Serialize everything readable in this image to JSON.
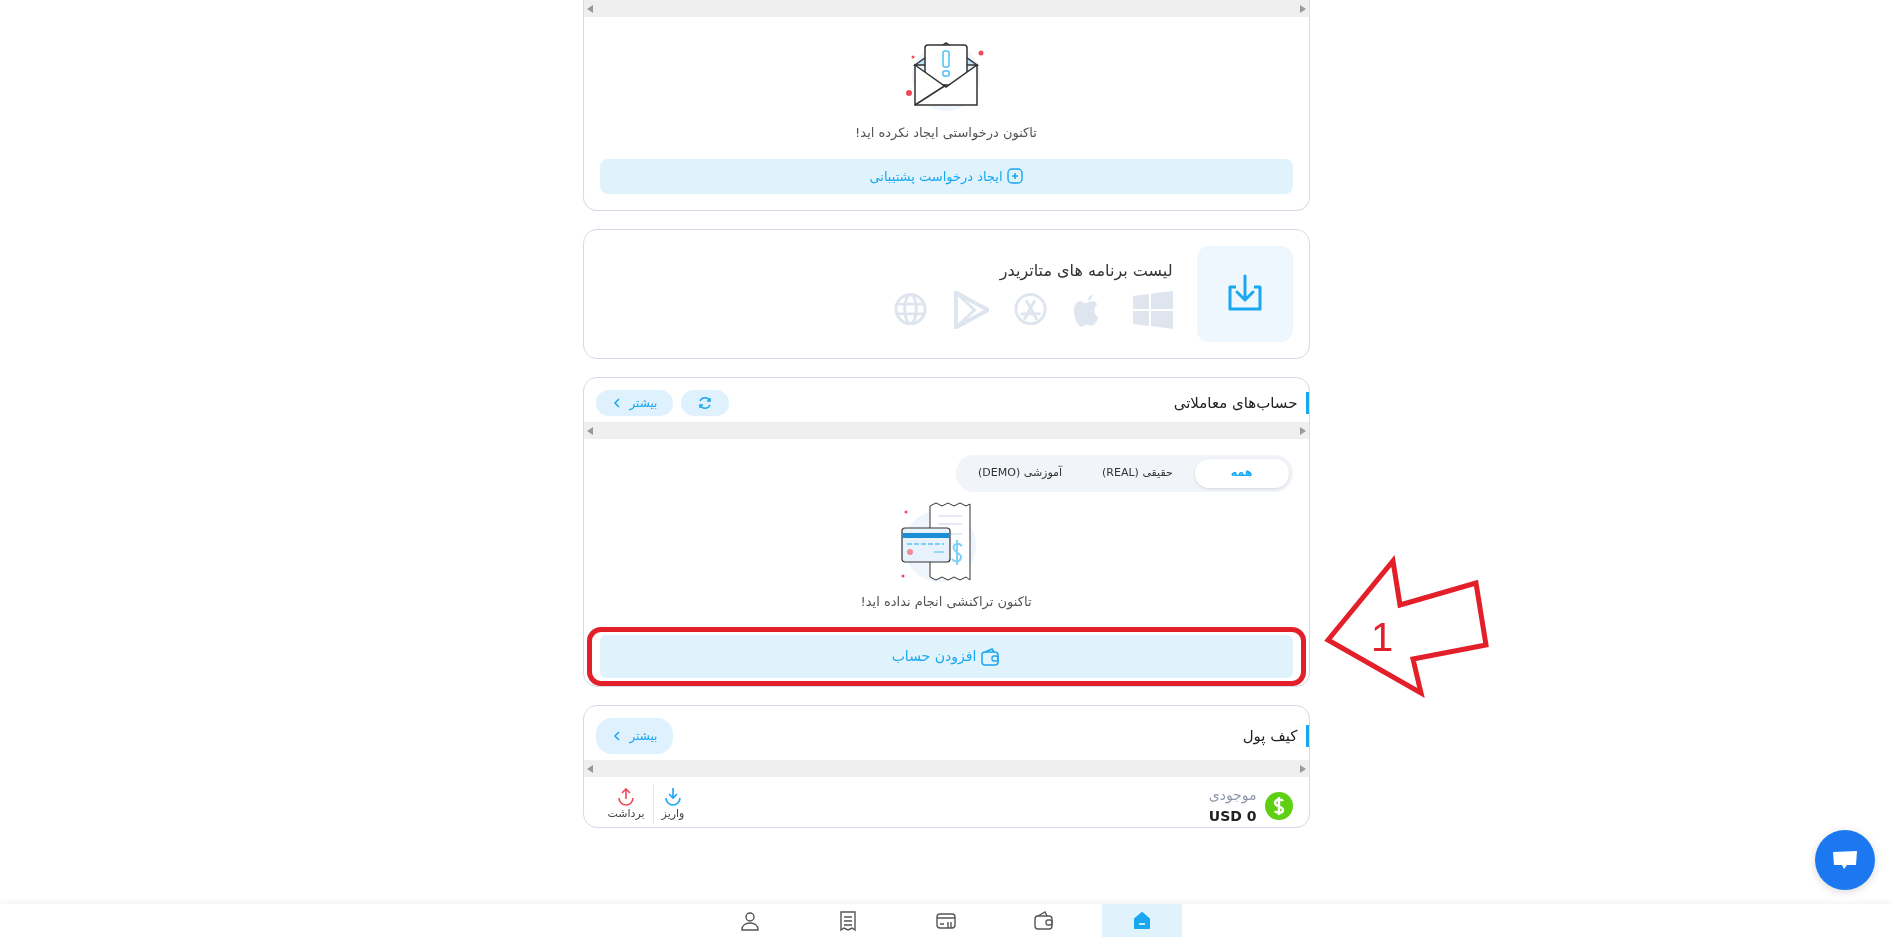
{
  "support": {
    "empty_message": "تاکنون درخواستی ایجاد نکرده اید!",
    "create_button": "ایجاد درخواست پشتیبانی"
  },
  "apps": {
    "title": "لیست برنامه های متاتریدر",
    "platforms": [
      {
        "kind": "windows"
      },
      {
        "kind": "apple"
      },
      {
        "kind": "appstore"
      },
      {
        "kind": "play"
      },
      {
        "kind": "web"
      }
    ]
  },
  "accounts": {
    "title": "حساب‌های معاملاتی",
    "more_button": "بیشتر",
    "tabs": [
      {
        "label": "همه",
        "selected": true
      },
      {
        "label": "حقیقی (REAL)",
        "selected": false
      },
      {
        "label": "آموزشی (DEMO)",
        "selected": false
      }
    ],
    "empty_message": "تاکنون تراکنشی انجام نداده اید!",
    "add_button": "افزودن حساب"
  },
  "annotation": {
    "label": "1"
  },
  "wallet": {
    "title": "کیف پول",
    "more_button": "بیشتر",
    "balance_label": "موجودی",
    "balance": "USD 0",
    "actions": [
      {
        "kind": "deposit",
        "label": "واریز"
      },
      {
        "kind": "withdraw",
        "label": "برداشت"
      }
    ]
  },
  "bottom_nav": [
    {
      "kind": "home",
      "selected": true
    },
    {
      "kind": "wallet",
      "selected": false
    },
    {
      "kind": "card",
      "selected": false
    },
    {
      "kind": "receipt",
      "selected": false
    },
    {
      "kind": "profile",
      "selected": false
    }
  ]
}
